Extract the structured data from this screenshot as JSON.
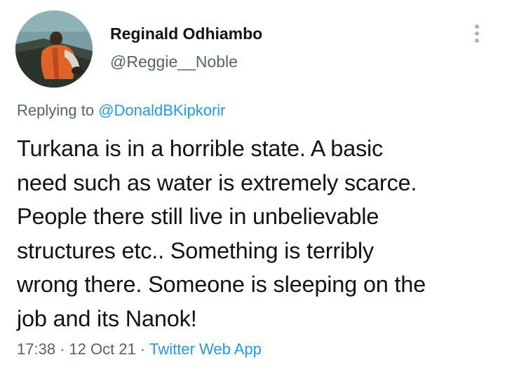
{
  "tweet": {
    "author": {
      "display_name": "Reginald Odhiambo",
      "handle": "@Reggie__Noble",
      "avatar_icon": "profile-photo"
    },
    "more_icon": "more-vertical-icon",
    "replying": {
      "prefix": "Replying to ",
      "mention": "@DonaldBKipkorir"
    },
    "text": "Turkana is in a horrible state. A basic\nneed such as water is extremely scarce.\nPeople there still live in unbelievable\nstructures etc.. Something is terribly\nwrong there. Someone is sleeping on the\njob and its Nanok!",
    "time": "17:38",
    "separator": "·",
    "date": "12 Oct 21",
    "source": "Twitter Web App"
  },
  "colors": {
    "text_primary": "#0f1419",
    "text_secondary": "#536471",
    "accent": "#1d9bf0",
    "background": "#ffffff"
  }
}
